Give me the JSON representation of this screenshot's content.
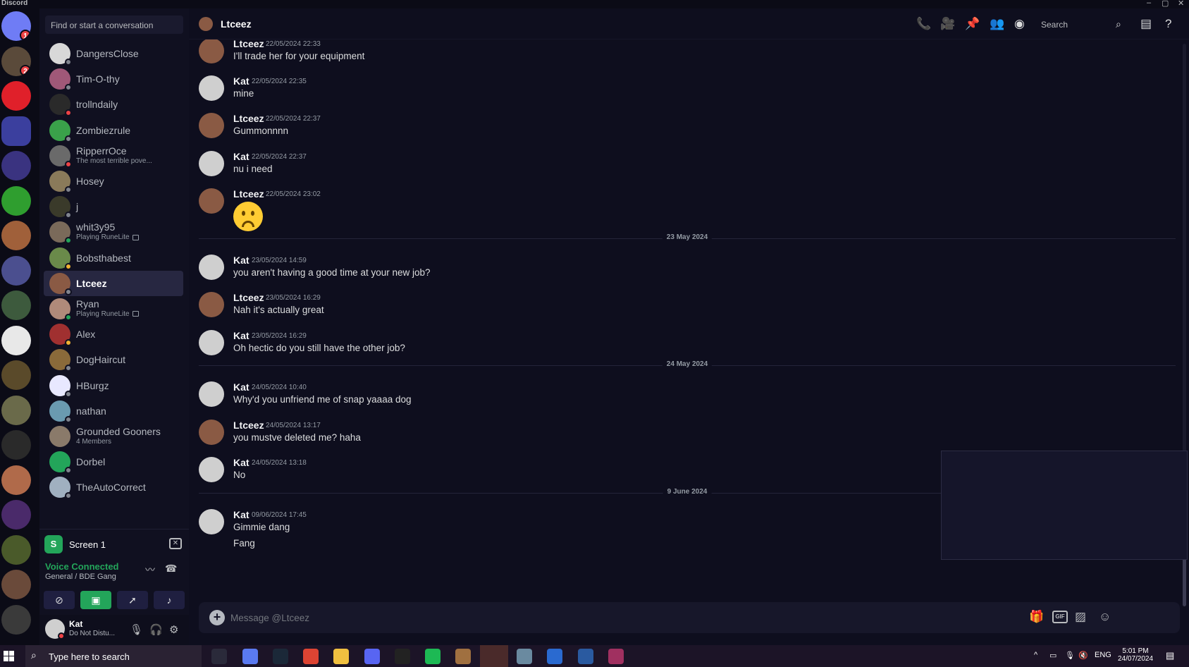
{
  "titlebar": {
    "app_name": "Discord",
    "min": "–",
    "max": "▢",
    "close": "✕"
  },
  "servers": [
    {
      "name": "home",
      "badge": "1",
      "color": "#6f7cf5"
    },
    {
      "name": "server-2",
      "badge": "2",
      "color": "#5a4a3a"
    },
    {
      "name": "server-3",
      "badge": "",
      "color": "#e0202a"
    },
    {
      "name": "folder",
      "badge": "",
      "color": "#3b3f9e"
    },
    {
      "name": "server-5",
      "badge": "",
      "color": "#3a3380"
    },
    {
      "name": "server-6",
      "badge": "",
      "color": "#2f9e2f"
    },
    {
      "name": "server-7",
      "badge": "",
      "color": "#a0603a"
    },
    {
      "name": "server-8",
      "badge": "",
      "color": "#4b4f8f"
    },
    {
      "name": "server-9",
      "badge": "",
      "color": "#3d5a3d"
    },
    {
      "name": "server-10",
      "badge": "",
      "color": "#e8e8e8"
    },
    {
      "name": "server-11",
      "badge": "",
      "color": "#5a4a2a"
    },
    {
      "name": "server-12",
      "badge": "",
      "color": "#6a6a4a"
    },
    {
      "name": "server-13",
      "badge": "",
      "color": "#2a2a2a"
    },
    {
      "name": "server-14",
      "badge": "",
      "color": "#b06a4a"
    },
    {
      "name": "server-15",
      "badge": "",
      "color": "#4a2a6a"
    },
    {
      "name": "server-16",
      "badge": "",
      "color": "#4a5a2a"
    },
    {
      "name": "server-17",
      "badge": "",
      "color": "#6a4a3a"
    },
    {
      "name": "server-18",
      "badge": "",
      "color": "#3a3a3a"
    }
  ],
  "sidebar": {
    "search_placeholder": "Find or start a conversation",
    "dms": [
      {
        "name": "DangersClose",
        "sub": "",
        "color": "#d8d8d8",
        "status": "#80848e"
      },
      {
        "name": "Tim-O-thy",
        "sub": "",
        "color": "#a05878",
        "status": "#80848e"
      },
      {
        "name": "trollndaily",
        "sub": "",
        "color": "#2a2a2a",
        "status": "#ed4245"
      },
      {
        "name": "Zombiezrule",
        "sub": "",
        "color": "#3aa14a",
        "status": "#80848e"
      },
      {
        "name": "RipperrOce",
        "sub": "The most terrible pove...",
        "color": "#6a6a6a",
        "status": "#ed4245"
      },
      {
        "name": "Hosey",
        "sub": "",
        "color": "#8a7a5a",
        "status": "#80848e"
      },
      {
        "name": "j",
        "sub": "",
        "color": "#3a3a2a",
        "status": "#80848e"
      },
      {
        "name": "whit3y95",
        "sub": "Playing RuneLite",
        "color": "#7a6a5a",
        "status": "#23a55a"
      },
      {
        "name": "Bobsthabest",
        "sub": "",
        "color": "#6a8a4a",
        "status": "#f0b232"
      },
      {
        "name": "Ltceez",
        "sub": "",
        "color": "#8a5a44",
        "status": "#80848e"
      },
      {
        "name": "Ryan",
        "sub": "Playing RuneLite",
        "color": "#b08a7a",
        "status": "#23a55a"
      },
      {
        "name": "Alex",
        "sub": "",
        "color": "#a03030",
        "status": "#f0b232"
      },
      {
        "name": "DogHaircut",
        "sub": "",
        "color": "#8a6a3a",
        "status": "#80848e"
      },
      {
        "name": "HBurgz",
        "sub": "",
        "color": "#e8e8ff",
        "status": "#80848e"
      },
      {
        "name": "nathan",
        "sub": "",
        "color": "#6a9ab0",
        "status": "#80848e"
      },
      {
        "name": "Grounded Gooners",
        "sub": "4 Members",
        "color": "#8a7a6a",
        "status": ""
      },
      {
        "name": "Dorbel",
        "sub": "",
        "color": "#23a55a",
        "status": "#80848e"
      },
      {
        "name": "TheAutoCorrect",
        "sub": "",
        "color": "#a0b0c0",
        "status": "#80848e"
      }
    ],
    "active_dm": "Ltceez"
  },
  "stream": {
    "label": "Screen 1",
    "icon_text": "S"
  },
  "voice": {
    "status": "Voice Connected",
    "channel": "General / BDE Gang"
  },
  "user": {
    "name": "Kat",
    "status": "Do Not Distu..."
  },
  "header": {
    "title": "Ltceez",
    "search_placeholder": "Search"
  },
  "messages": [
    {
      "author": "Ltceez",
      "time": "22/05/2024 22:33",
      "text": "I'll trade her for your equipment",
      "text2": "",
      "emoji": false
    },
    {
      "author": "Kat",
      "time": "22/05/2024 22:35",
      "text": "mine",
      "text2": "",
      "emoji": false
    },
    {
      "author": "Ltceez",
      "time": "22/05/2024 22:37",
      "text": "Gummonnnn",
      "text2": "",
      "emoji": false
    },
    {
      "author": "Kat",
      "time": "22/05/2024 22:37",
      "text": "nu i need",
      "text2": "",
      "emoji": false
    },
    {
      "author": "Ltceez",
      "time": "22/05/2024 23:02",
      "text": "",
      "text2": "",
      "emoji": true
    },
    {
      "author": "Kat",
      "time": "23/05/2024 14:59",
      "text": "you aren't having a good time at your new job?",
      "text2": "",
      "emoji": false
    },
    {
      "author": "Ltceez",
      "time": "23/05/2024 16:29",
      "text": "Nah it's actually great",
      "text2": "",
      "emoji": false
    },
    {
      "author": "Kat",
      "time": "23/05/2024 16:29",
      "text": "Oh hectic do you still have the other job?",
      "text2": "",
      "emoji": false
    },
    {
      "author": "Kat",
      "time": "24/05/2024 10:40",
      "text": "Why'd you unfriend me of snap yaaaa dog",
      "text2": "",
      "emoji": false
    },
    {
      "author": "Ltceez",
      "time": "24/05/2024 13:17",
      "text": "you mustve deleted me? haha",
      "text2": "",
      "emoji": false
    },
    {
      "author": "Kat",
      "time": "24/05/2024 13:18",
      "text": "No",
      "text2": "",
      "emoji": false
    },
    {
      "author": "Kat",
      "time": "09/06/2024 17:45",
      "text": "Gimmie dang",
      "text2": "Fang",
      "emoji": false
    }
  ],
  "dividers": [
    "23 May 2024",
    "24 May 2024",
    "9 June 2024"
  ],
  "composer": {
    "placeholder": "Message @Ltceez",
    "gif": "GIF"
  },
  "taskbar": {
    "search_placeholder": "Type here to search",
    "lang": "ENG",
    "time": "5:01 PM",
    "date": "24/07/2024",
    "apps": [
      "task-view",
      "copilot",
      "steam",
      "chrome",
      "file-explorer",
      "discord",
      "x",
      "spotify",
      "runelite",
      "ea",
      "game-1",
      "game-2",
      "game-3",
      "game-4"
    ]
  },
  "colors": {
    "kat_avatar": "#cfcfcf",
    "ltceez_avatar": "#8a5a44",
    "accent_green": "#23a55a",
    "dnd_red": "#ed4245"
  }
}
